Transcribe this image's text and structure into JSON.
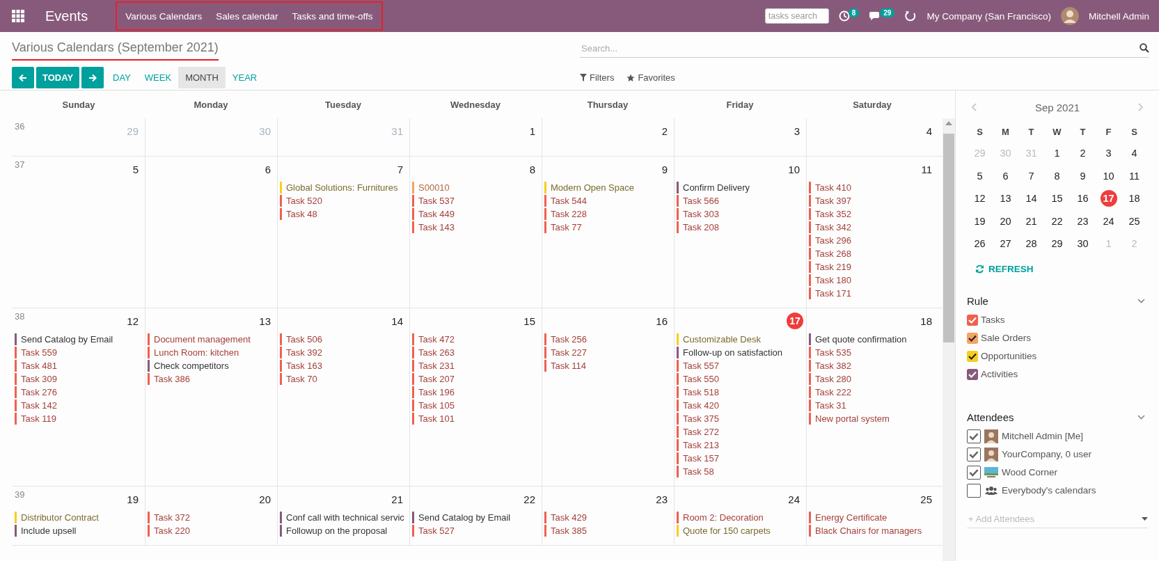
{
  "navbar": {
    "app_title": "Events",
    "menu": [
      "Various Calendars",
      "Sales calendar",
      "Tasks and time-offs"
    ],
    "search_placeholder": "tasks search",
    "activity_count": "8",
    "message_count": "29",
    "company": "My Company (San Francisco)",
    "user": "Mitchell Admin"
  },
  "control_panel": {
    "title": "Various Calendars (September 2021)",
    "search_placeholder": "Search...",
    "today": "TODAY",
    "scales": [
      {
        "label": "DAY",
        "selected": false
      },
      {
        "label": "WEEK",
        "selected": false
      },
      {
        "label": "MONTH",
        "selected": true
      },
      {
        "label": "YEAR",
        "selected": false
      }
    ],
    "filters": "Filters",
    "favorites": "Favorites"
  },
  "calendar": {
    "weekdays": [
      "Sunday",
      "Monday",
      "Tuesday",
      "Wednesday",
      "Thursday",
      "Friday",
      "Saturday"
    ],
    "weeks": [
      {
        "number": "36",
        "days": [
          {
            "date": "29",
            "other_month": true,
            "today": false
          },
          {
            "date": "30",
            "other_month": true,
            "today": false
          },
          {
            "date": "31",
            "other_month": true,
            "today": false
          },
          {
            "date": "1",
            "other_month": false,
            "today": false
          },
          {
            "date": "2",
            "other_month": false,
            "today": false
          },
          {
            "date": "3",
            "other_month": false,
            "today": false
          },
          {
            "date": "4",
            "other_month": false,
            "today": false
          }
        ]
      },
      {
        "number": "37",
        "days": [
          {
            "date": "5",
            "other_month": false,
            "today": false
          },
          {
            "date": "6",
            "other_month": false,
            "today": false
          },
          {
            "date": "7",
            "other_month": false,
            "today": false,
            "events": [
              {
                "title": "Global Solutions: Furnitures",
                "kind": "opportunity"
              },
              {
                "title": "Task 520",
                "kind": "task"
              },
              {
                "title": "Task 48",
                "kind": "task"
              }
            ]
          },
          {
            "date": "8",
            "other_month": false,
            "today": false,
            "events": [
              {
                "title": "S00010",
                "kind": "sale"
              },
              {
                "title": "Task 537",
                "kind": "task"
              },
              {
                "title": "Task 449",
                "kind": "task"
              },
              {
                "title": "Task 143",
                "kind": "task"
              }
            ]
          },
          {
            "date": "9",
            "other_month": false,
            "today": false,
            "events": [
              {
                "title": "Modern Open Space",
                "kind": "opportunity"
              },
              {
                "title": "Task 544",
                "kind": "task"
              },
              {
                "title": "Task 228",
                "kind": "task"
              },
              {
                "title": "Task 77",
                "kind": "task"
              }
            ]
          },
          {
            "date": "10",
            "other_month": false,
            "today": false,
            "events": [
              {
                "title": "Confirm Delivery",
                "kind": "activity"
              },
              {
                "title": "Task 566",
                "kind": "task"
              },
              {
                "title": "Task 303",
                "kind": "task"
              },
              {
                "title": "Task 208",
                "kind": "task"
              }
            ]
          },
          {
            "date": "11",
            "other_month": false,
            "today": false,
            "events": [
              {
                "title": "Task 410",
                "kind": "task"
              },
              {
                "title": "Task 397",
                "kind": "task"
              },
              {
                "title": "Task 352",
                "kind": "task"
              },
              {
                "title": "Task 342",
                "kind": "task"
              },
              {
                "title": "Task 296",
                "kind": "task"
              },
              {
                "title": "Task 268",
                "kind": "task"
              },
              {
                "title": "Task 219",
                "kind": "task"
              },
              {
                "title": "Task 180",
                "kind": "task"
              },
              {
                "title": "Task 171",
                "kind": "task"
              }
            ]
          }
        ]
      },
      {
        "number": "38",
        "days": [
          {
            "date": "12",
            "other_month": false,
            "today": false,
            "events": [
              {
                "title": "Send Catalog by Email",
                "kind": "activity"
              },
              {
                "title": "Task 559",
                "kind": "task"
              },
              {
                "title": "Task 481",
                "kind": "task"
              },
              {
                "title": "Task 309",
                "kind": "task"
              },
              {
                "title": "Task 276",
                "kind": "task"
              },
              {
                "title": "Task 142",
                "kind": "task"
              },
              {
                "title": "Task 119",
                "kind": "task"
              }
            ]
          },
          {
            "date": "13",
            "other_month": false,
            "today": false,
            "events": [
              {
                "title": "Document management",
                "kind": "task"
              },
              {
                "title": "Lunch Room: kitchen",
                "kind": "task"
              },
              {
                "title": "Check competitors",
                "kind": "activity"
              },
              {
                "title": "Task 386",
                "kind": "task"
              }
            ]
          },
          {
            "date": "14",
            "other_month": false,
            "today": false,
            "events": [
              {
                "title": "Task 506",
                "kind": "task"
              },
              {
                "title": "Task 392",
                "kind": "task"
              },
              {
                "title": "Task 163",
                "kind": "task"
              },
              {
                "title": "Task 70",
                "kind": "task"
              }
            ]
          },
          {
            "date": "15",
            "other_month": false,
            "today": false,
            "events": [
              {
                "title": "Task 472",
                "kind": "task"
              },
              {
                "title": "Task 263",
                "kind": "task"
              },
              {
                "title": "Task 231",
                "kind": "task"
              },
              {
                "title": "Task 207",
                "kind": "task"
              },
              {
                "title": "Task 196",
                "kind": "task"
              },
              {
                "title": "Task 105",
                "kind": "task"
              },
              {
                "title": "Task 101",
                "kind": "task"
              }
            ]
          },
          {
            "date": "16",
            "other_month": false,
            "today": false,
            "events": [
              {
                "title": "Task 256",
                "kind": "task"
              },
              {
                "title": "Task 227",
                "kind": "task"
              },
              {
                "title": "Task 114",
                "kind": "task"
              }
            ]
          },
          {
            "date": "17",
            "other_month": false,
            "today": true,
            "events": [
              {
                "title": "Customizable Desk",
                "kind": "opportunity"
              },
              {
                "title": "Follow-up on satisfaction",
                "kind": "activity"
              },
              {
                "title": "Task 557",
                "kind": "task"
              },
              {
                "title": "Task 550",
                "kind": "task"
              },
              {
                "title": "Task 518",
                "kind": "task"
              },
              {
                "title": "Task 420",
                "kind": "task"
              },
              {
                "title": "Task 375",
                "kind": "task"
              },
              {
                "title": "Task 272",
                "kind": "task"
              },
              {
                "title": "Task 213",
                "kind": "task"
              },
              {
                "title": "Task 157",
                "kind": "task"
              },
              {
                "title": "Task 58",
                "kind": "task"
              }
            ]
          },
          {
            "date": "18",
            "other_month": false,
            "today": false,
            "events": [
              {
                "title": "Get quote confirmation",
                "kind": "activity"
              },
              {
                "title": "Task 535",
                "kind": "task"
              },
              {
                "title": "Task 382",
                "kind": "task"
              },
              {
                "title": "Task 280",
                "kind": "task"
              },
              {
                "title": "Task 222",
                "kind": "task"
              },
              {
                "title": "Task 31",
                "kind": "task"
              },
              {
                "title": "New portal system",
                "kind": "task"
              }
            ]
          }
        ]
      },
      {
        "number": "39",
        "days": [
          {
            "date": "19",
            "other_month": false,
            "today": false,
            "events": [
              {
                "title": "Distributor Contract",
                "kind": "opportunity"
              },
              {
                "title": "Include upsell",
                "kind": "activity"
              }
            ]
          },
          {
            "date": "20",
            "other_month": false,
            "today": false,
            "events": [
              {
                "title": "Task 372",
                "kind": "task"
              },
              {
                "title": "Task 220",
                "kind": "task"
              }
            ]
          },
          {
            "date": "21",
            "other_month": false,
            "today": false,
            "events": [
              {
                "title": "Conf call with technical servic",
                "kind": "activity"
              },
              {
                "title": "Followup on the proposal",
                "kind": "activity"
              }
            ]
          },
          {
            "date": "22",
            "other_month": false,
            "today": false,
            "events": [
              {
                "title": "Send Catalog by Email",
                "kind": "activity"
              },
              {
                "title": "Task 527",
                "kind": "task"
              }
            ]
          },
          {
            "date": "23",
            "other_month": false,
            "today": false,
            "events": [
              {
                "title": "Task 429",
                "kind": "task"
              },
              {
                "title": "Task 385",
                "kind": "task"
              }
            ]
          },
          {
            "date": "24",
            "other_month": false,
            "today": false,
            "events": [
              {
                "title": "Room 2: Decoration",
                "kind": "task"
              },
              {
                "title": "Quote for 150 carpets",
                "kind": "opportunity"
              }
            ]
          },
          {
            "date": "25",
            "other_month": false,
            "today": false,
            "events": [
              {
                "title": "Energy Certificate",
                "kind": "task"
              },
              {
                "title": "Black Chairs for managers",
                "kind": "task"
              }
            ]
          }
        ]
      }
    ]
  },
  "sidebar": {
    "mini_calendar": {
      "title": "Sep 2021",
      "weekdays": [
        "S",
        "M",
        "T",
        "W",
        "T",
        "F",
        "S"
      ],
      "weeks": [
        [
          {
            "date": "29",
            "other_month": true,
            "selected": false
          },
          {
            "date": "30",
            "other_month": true,
            "selected": false
          },
          {
            "date": "31",
            "other_month": true,
            "selected": false
          },
          {
            "date": "1",
            "other_month": false,
            "selected": false
          },
          {
            "date": "2",
            "other_month": false,
            "selected": false
          },
          {
            "date": "3",
            "other_month": false,
            "selected": false
          },
          {
            "date": "4",
            "other_month": false,
            "selected": false
          }
        ],
        [
          {
            "date": "5",
            "other_month": false,
            "selected": false
          },
          {
            "date": "6",
            "other_month": false,
            "selected": false
          },
          {
            "date": "7",
            "other_month": false,
            "selected": false
          },
          {
            "date": "8",
            "other_month": false,
            "selected": false
          },
          {
            "date": "9",
            "other_month": false,
            "selected": false
          },
          {
            "date": "10",
            "other_month": false,
            "selected": false
          },
          {
            "date": "11",
            "other_month": false,
            "selected": false
          }
        ],
        [
          {
            "date": "12",
            "other_month": false,
            "selected": false
          },
          {
            "date": "13",
            "other_month": false,
            "selected": false
          },
          {
            "date": "14",
            "other_month": false,
            "selected": false
          },
          {
            "date": "15",
            "other_month": false,
            "selected": false
          },
          {
            "date": "16",
            "other_month": false,
            "selected": false
          },
          {
            "date": "17",
            "other_month": false,
            "selected": true
          },
          {
            "date": "18",
            "other_month": false,
            "selected": false
          }
        ],
        [
          {
            "date": "19",
            "other_month": false,
            "selected": false
          },
          {
            "date": "20",
            "other_month": false,
            "selected": false
          },
          {
            "date": "21",
            "other_month": false,
            "selected": false
          },
          {
            "date": "22",
            "other_month": false,
            "selected": false
          },
          {
            "date": "23",
            "other_month": false,
            "selected": false
          },
          {
            "date": "24",
            "other_month": false,
            "selected": false
          },
          {
            "date": "25",
            "other_month": false,
            "selected": false
          }
        ],
        [
          {
            "date": "26",
            "other_month": false,
            "selected": false
          },
          {
            "date": "27",
            "other_month": false,
            "selected": false
          },
          {
            "date": "28",
            "other_month": false,
            "selected": false
          },
          {
            "date": "29",
            "other_month": false,
            "selected": false
          },
          {
            "date": "30",
            "other_month": false,
            "selected": false
          },
          {
            "date": "1",
            "other_month": true,
            "selected": false
          },
          {
            "date": "2",
            "other_month": true,
            "selected": false
          }
        ]
      ]
    },
    "refresh": "REFRESH",
    "rule": {
      "title": "Rule",
      "items": [
        {
          "label": "Tasks",
          "kind": "task",
          "color": "#f06050",
          "checked": true
        },
        {
          "label": "Sale Orders",
          "kind": "sale",
          "color": "#f4a460",
          "checked": true
        },
        {
          "label": "Opportunities",
          "kind": "opportunity",
          "color": "#f7cd1f",
          "checked": true
        },
        {
          "label": "Activities",
          "kind": "activity",
          "color": "#875a7b",
          "checked": true
        }
      ]
    },
    "attendees": {
      "title": "Attendees",
      "items": [
        {
          "label": "Mitchell Admin [Me]",
          "kind": "user",
          "checked": true
        },
        {
          "label": "YourCompany, 0 user",
          "kind": "user",
          "checked": true
        },
        {
          "label": "Wood Corner",
          "kind": "company",
          "checked": true
        },
        {
          "label": "Everybody's calendars",
          "kind": "everybody",
          "checked": false
        }
      ],
      "add_placeholder": "+ Add Attendees"
    }
  }
}
